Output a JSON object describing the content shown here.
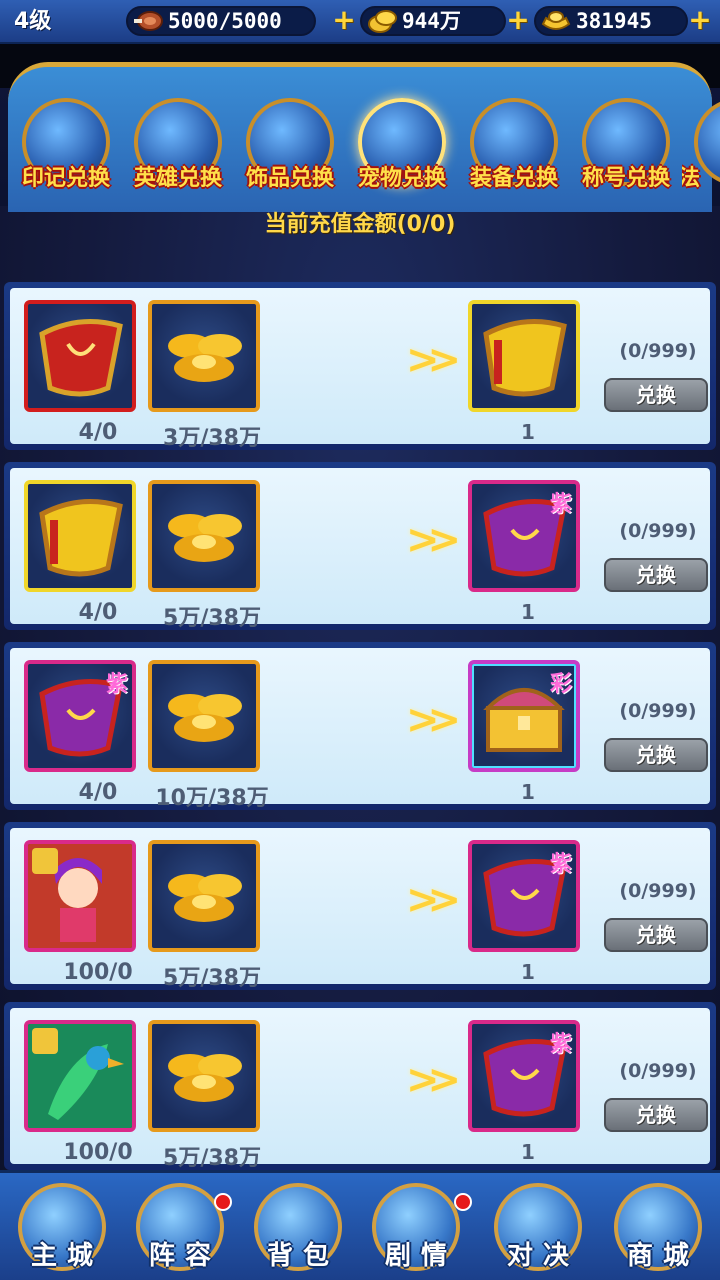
{
  "topbar": {
    "level": "4级",
    "stamina": "5000/5000",
    "gold": "944万",
    "ingots": "381945",
    "plus_symbol": "+"
  },
  "categories": [
    {
      "label": "印记兑换",
      "icon": "dragon-icon",
      "active": false
    },
    {
      "label": "英雄兑换",
      "icon": "lion-icon",
      "active": false
    },
    {
      "label": "饰品兑换",
      "icon": "jewelry-icon",
      "active": false
    },
    {
      "label": "宠物兑换",
      "icon": "pet-cat-icon",
      "active": true
    },
    {
      "label": "装备兑换",
      "icon": "armor-icon",
      "active": false
    },
    {
      "label": "称号兑换",
      "icon": "golden-statue-icon",
      "active": false
    },
    {
      "label": "法",
      "icon": "magic-icon",
      "active": false
    }
  ],
  "recharge_label": "当前充值金额(0/0)",
  "exchange_arrow": ">>",
  "rows": [
    {
      "item1": {
        "icon": "red-cape-box-icon",
        "frame": "red",
        "count": "4/0"
      },
      "item2": {
        "icon": "gold-ingots-icon",
        "frame": "orange",
        "count": "3万/38万"
      },
      "reward": {
        "icon": "yellow-cape-box-icon",
        "frame": "yellow",
        "grade": "",
        "count": "1"
      },
      "limit": "(0/999)",
      "button": "兑换"
    },
    {
      "item1": {
        "icon": "yellow-cape-box-icon",
        "frame": "yellow",
        "count": "4/0"
      },
      "item2": {
        "icon": "gold-ingots-icon",
        "frame": "orange",
        "count": "5万/38万"
      },
      "reward": {
        "icon": "purple-cape-box-icon",
        "frame": "purple",
        "grade": "紫",
        "count": "1"
      },
      "limit": "(0/999)",
      "button": "兑换"
    },
    {
      "item1": {
        "icon": "purple-cape-box-icon",
        "frame": "purple",
        "grade": "紫",
        "count": "4/0"
      },
      "item2": {
        "icon": "gold-ingots-icon",
        "frame": "orange",
        "count": "10万/38万"
      },
      "reward": {
        "icon": "treasure-chest-icon",
        "frame": "rainbow",
        "grade": "彩",
        "count": "1"
      },
      "limit": "(0/999)",
      "button": "兑换"
    },
    {
      "item1": {
        "icon": "hero-fragment-girl-icon",
        "frame": "purple",
        "count": "100/0"
      },
      "item2": {
        "icon": "gold-ingots-icon",
        "frame": "orange",
        "count": "5万/38万"
      },
      "reward": {
        "icon": "purple-cape-box-icon",
        "frame": "purple",
        "grade": "紫",
        "count": "1"
      },
      "limit": "(0/999)",
      "button": "兑换"
    },
    {
      "item1": {
        "icon": "phoenix-fragment-icon",
        "frame": "purple",
        "count": "100/0"
      },
      "item2": {
        "icon": "gold-ingots-icon",
        "frame": "orange",
        "count": "5万/38万"
      },
      "reward": {
        "icon": "purple-cape-box-icon",
        "frame": "purple",
        "grade": "紫",
        "count": "1"
      },
      "limit": "(0/999)",
      "button": "兑换"
    }
  ],
  "bottom_nav": [
    {
      "label": "主城",
      "icon": "palace-icon",
      "badge": false
    },
    {
      "label": "阵容",
      "icon": "heroes-icon",
      "badge": true
    },
    {
      "label": "背包",
      "icon": "bag-icon",
      "badge": false
    },
    {
      "label": "剧情",
      "icon": "story-statue-icon",
      "badge": true
    },
    {
      "label": "对决",
      "icon": "crossed-swords-icon",
      "badge": false
    },
    {
      "label": "商城",
      "icon": "shop-coin-icon",
      "badge": false
    }
  ]
}
